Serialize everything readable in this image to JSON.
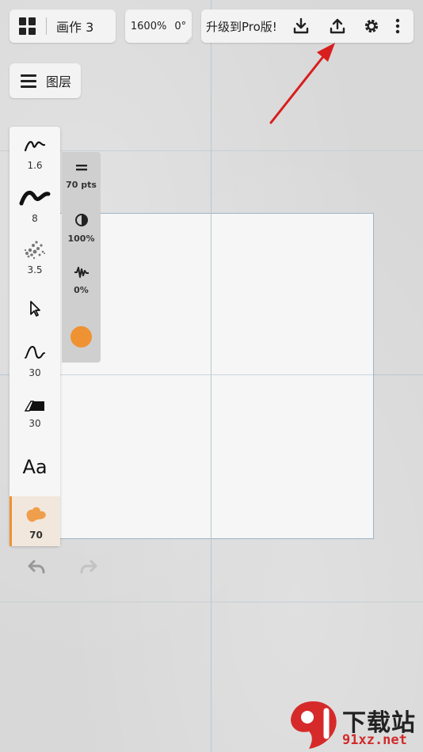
{
  "topbar": {
    "menu_icon": "grid-menu-icon",
    "doc_title": "画作 3",
    "zoom": "1600%",
    "rotation": "0°",
    "upgrade_label": "升级到Pro版!",
    "icons": [
      "download-icon",
      "upload-icon",
      "gear-icon",
      "more-vertical-icon"
    ]
  },
  "layers": {
    "label": "图层",
    "icon": "layers-icon"
  },
  "tools": [
    {
      "name": "pencil-brush",
      "value": "1.6"
    },
    {
      "name": "ink-brush",
      "value": "8"
    },
    {
      "name": "spray-brush",
      "value": "3.5"
    },
    {
      "name": "select-pointer",
      "value": ""
    },
    {
      "name": "smudge-curve",
      "value": "30"
    },
    {
      "name": "eraser",
      "value": "30"
    },
    {
      "name": "text-tool",
      "label": "Aa"
    },
    {
      "name": "fill-blob",
      "value": "70"
    }
  ],
  "properties": {
    "size": "70 pts",
    "opacity": "100%",
    "jitter": "0%",
    "color": "#ef9233"
  },
  "history": {
    "undo_icon": "undo-icon",
    "redo_icon": "redo-icon"
  },
  "watermark": {
    "text": "下载站",
    "url": "91xz.net"
  },
  "colors": {
    "accent": "#ef9233",
    "arrow": "#d81e1e",
    "toolbar_bg": "#f3f3f3"
  }
}
